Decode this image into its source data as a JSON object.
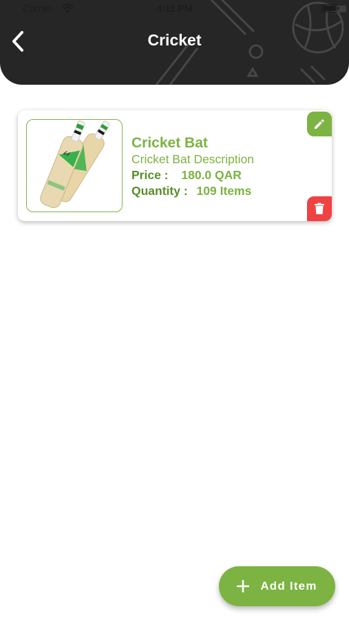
{
  "status_bar": {
    "carrier": "Carrier",
    "time": "4:11 PM",
    "wifi_icon": "wifi-icon",
    "battery_icon": "battery-icon"
  },
  "header": {
    "title": "Cricket",
    "back_icon": "chevron-left-icon",
    "background_color": "#262626"
  },
  "product": {
    "name": "Cricket Bat",
    "description": "Cricket Bat Description",
    "price_label": "Price :",
    "price_value": "180.0 QAR",
    "quantity_label": "Quantity :",
    "quantity_value": "109 Items",
    "image_icon": "cricket-bat-image",
    "edit_icon": "pencil-icon",
    "delete_icon": "trash-icon"
  },
  "fab": {
    "label": "Add Item",
    "icon": "plus-icon"
  },
  "colors": {
    "accent": "#7cb342",
    "danger": "#ef4242",
    "header": "#262626"
  }
}
